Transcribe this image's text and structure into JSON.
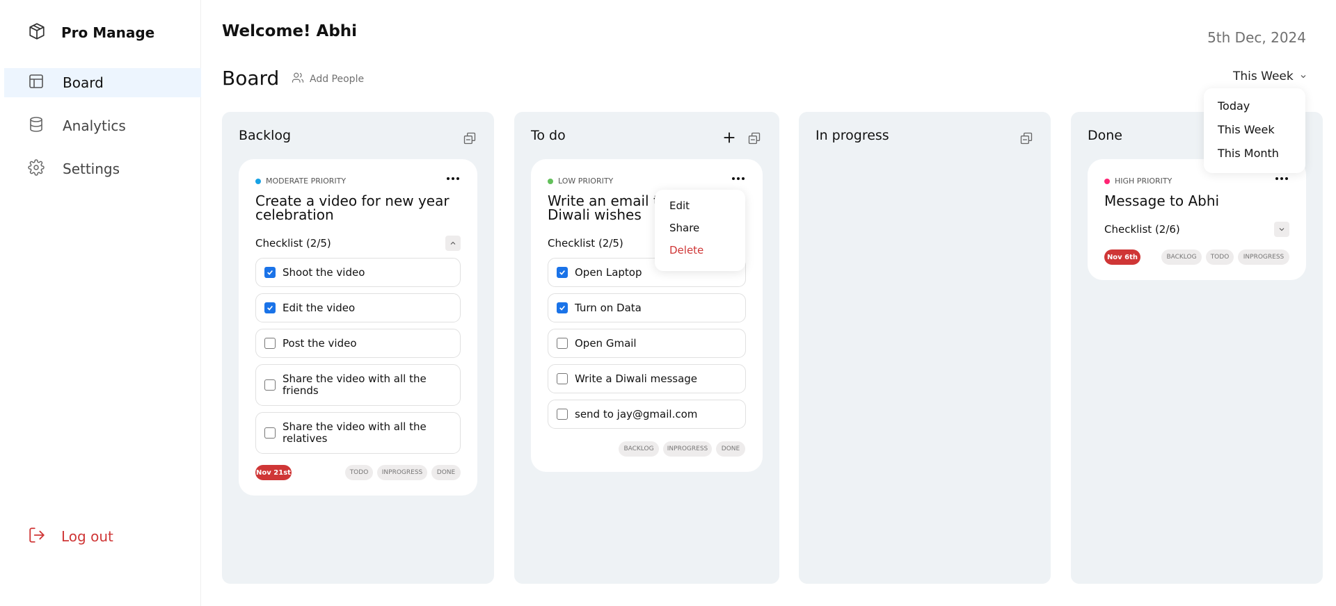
{
  "app": {
    "name": "Pro Manage"
  },
  "sidebar": {
    "items": [
      {
        "label": "Board",
        "icon": "layout-icon",
        "active": true
      },
      {
        "label": "Analytics",
        "icon": "database-icon",
        "active": false
      },
      {
        "label": "Settings",
        "icon": "gear-icon",
        "active": false
      }
    ],
    "logout_label": "Log out"
  },
  "header": {
    "welcome": "Welcome! Abhi",
    "date": "5th Dec, 2024",
    "board_title": "Board",
    "add_people_label": "Add People",
    "filter_selected": "This Week",
    "filter_options": [
      "Today",
      "This Week",
      "This Month"
    ]
  },
  "colors": {
    "accent_blue": "#1a73e8",
    "danger_red": "#cf3636",
    "moderate": "#17a2e5",
    "low": "#63c05b",
    "high": "#ff2473",
    "column_bg": "#eef2f5",
    "active_nav_bg": "#edf5fe"
  },
  "columns": {
    "backlog": {
      "title": "Backlog",
      "card": {
        "priority": "MODERATE PRIORITY",
        "title": "Create a video for new year celebration",
        "checklist_label": "Checklist (2/5)",
        "tasks": [
          {
            "label": "Shoot the video",
            "checked": true
          },
          {
            "label": "Edit the video",
            "checked": true
          },
          {
            "label": "Post the video",
            "checked": false
          },
          {
            "label": "Share the video with all the friends",
            "checked": false
          },
          {
            "label": "Share the video with all the relatives",
            "checked": false
          }
        ],
        "due": "Nov 21st",
        "moves": [
          "TODO",
          "INPROGRESS",
          "DONE"
        ]
      }
    },
    "todo": {
      "title": "To do",
      "card": {
        "priority": "LOW PRIORITY",
        "title": "Write an email to Diwali wishes",
        "checklist_label": "Checklist (2/5)",
        "tasks": [
          {
            "label": "Open Laptop",
            "checked": true
          },
          {
            "label": "Turn on Data",
            "checked": true
          },
          {
            "label": "Open Gmail",
            "checked": false
          },
          {
            "label": "Write a Diwali message",
            "checked": false
          },
          {
            "label": "send to jay@gmail.com",
            "checked": false
          }
        ],
        "moves": [
          "BACKLOG",
          "INPROGRESS",
          "DONE"
        ]
      },
      "context_menu": [
        "Edit",
        "Share",
        "Delete"
      ]
    },
    "inprogress": {
      "title": "In progress"
    },
    "done": {
      "title": "Done",
      "card": {
        "priority": "HIGH PRIORITY",
        "title": "Message to Abhi",
        "checklist_label": "Checklist (2/6)",
        "due": "Nov 6th",
        "moves": [
          "BACKLOG",
          "TODO",
          "INPROGRESS"
        ]
      }
    }
  }
}
